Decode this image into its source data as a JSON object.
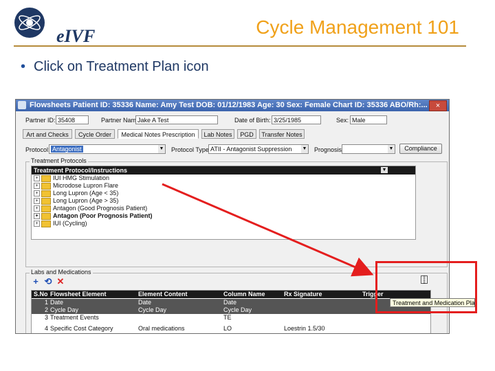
{
  "header": {
    "logo_text": "eIVF",
    "title": "Cycle Management 101"
  },
  "instruction": {
    "bullet": "•",
    "text": "Click on Treatment Plan icon"
  },
  "window": {
    "title": "Flowsheets  Patient ID: 35336  Name: Amy Test  DOB: 01/12/1983  Age: 30  Sex: Female  Chart ID: 35336  ABO/Rh:...",
    "close": "×",
    "partner_id_label": "Partner ID:",
    "partner_id_value": "35408",
    "partner_name_label": "Partner Name",
    "partner_name_value": "Jake A Test",
    "dob_label": "Date of Birth:",
    "dob_value": "3/25/1985",
    "sex_label": "Sex:",
    "sex_value": "Male",
    "tabs": [
      "Art and Checks",
      "Cycle Order",
      "Medical Notes Prescription",
      "Lab Notes",
      "PGD",
      "Transfer Notes"
    ],
    "protocol_label": "Protocol:",
    "protocol_value": "Antagonist",
    "protocol_type_label": "Protocol Type:",
    "protocol_type_value": "ATII - Antagonist Suppression",
    "prognosis_label": "Prognosis:",
    "prognosis_value": "",
    "compliance_button": "Compliance",
    "treatment_protocols_group": "Treatment Protocols",
    "tree_header": "Treatment Protocol/Instructions",
    "tree_items": [
      {
        "label": "IUI HMG Stimulation",
        "bold": false
      },
      {
        "label": "Microdose Lupron Flare",
        "bold": false
      },
      {
        "label": "Long Lupron (Age < 35)",
        "bold": false
      },
      {
        "label": "Long Lupron (Age > 35)",
        "bold": false
      },
      {
        "label": "Antagon (Good Prognosis Patient)",
        "bold": false
      },
      {
        "label": "Antagon (Poor Prognosis Patient)",
        "bold": true
      },
      {
        "label": "IUI (Cycling)",
        "bold": false
      }
    ],
    "labs_group": "Labs and Medications",
    "grid_headers": [
      "S.No",
      "Flowsheet Element",
      "Element Content",
      "Column Name",
      "Rx Signature",
      "Trigger"
    ],
    "grid_rows": [
      {
        "no": "1",
        "element": "Date",
        "content": "Date",
        "column": "Date",
        "rx": "",
        "dark": true
      },
      {
        "no": "2",
        "element": "Cycle Day",
        "content": "Cycle Day",
        "column": "Cycle Day",
        "rx": "",
        "dark": true
      },
      {
        "no": "3",
        "element": "Treatment Events",
        "content": "",
        "column": "TE",
        "rx": "",
        "dark": false
      },
      {
        "no": "4",
        "element": "Specific Cost Category",
        "content": "Oral medications",
        "column": "LO",
        "rx": "Loestrin 1.5/30",
        "dark": false
      }
    ],
    "tooltip": "Treatment and Medication Plan"
  },
  "colors": {
    "title": "#f0a11a",
    "highlight": "#e41e1e",
    "bullet_text": "#1f3864"
  }
}
